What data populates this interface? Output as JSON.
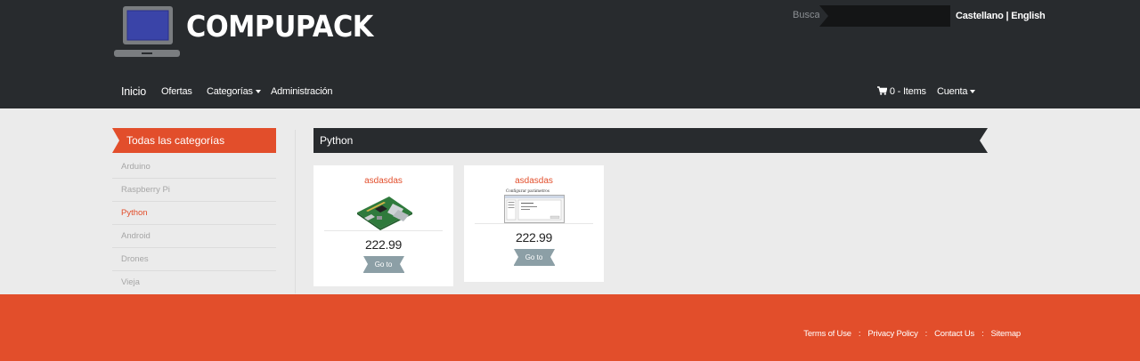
{
  "header": {
    "brand": "COMPUPACK",
    "search_label": "Buscar",
    "search_value": "",
    "lang_es": "Castellano",
    "lang_sep": " | ",
    "lang_en": "English"
  },
  "nav": {
    "home": "Inicio",
    "offers": "Ofertas",
    "categories": "Categorías",
    "admin": "Administración",
    "cart": "0 - Items",
    "account": "Cuenta"
  },
  "sidebar": {
    "title": "Todas las categorías",
    "items": [
      {
        "label": "Arduino"
      },
      {
        "label": "Raspberry Pi"
      },
      {
        "label": "Python"
      },
      {
        "label": "Android"
      },
      {
        "label": "Drones"
      },
      {
        "label": "Vieja"
      }
    ],
    "active": "Python"
  },
  "section": {
    "title": "Python"
  },
  "products": [
    {
      "name": "asdasdas",
      "price": "222.99",
      "button": "Go to",
      "image": "raspberry-pi-board"
    },
    {
      "name": "asdasdas",
      "price": "222.99",
      "button": "Go to",
      "image": "configuration-window-screenshot",
      "image_caption": "Configurar parámetros"
    }
  ],
  "footer": {
    "links": [
      "Terms of Use",
      "Privacy Policy",
      "Contact Us",
      "Sitemap"
    ],
    "separator": ":"
  },
  "colors": {
    "accent": "#e24e2b",
    "dark": "#282b2e",
    "background": "#ebebeb",
    "button": "#8c9fa6"
  }
}
